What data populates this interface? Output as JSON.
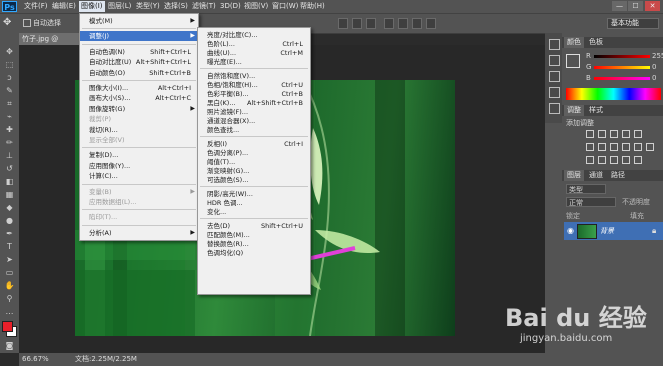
{
  "app": {
    "logo": "Ps"
  },
  "menubar": {
    "items": [
      "文件(F)",
      "编辑(E)",
      "图像(I)",
      "图层(L)",
      "类型(Y)",
      "选择(S)",
      "滤镜(T)",
      "3D(D)",
      "视图(V)",
      "窗口(W)",
      "帮助(H)"
    ],
    "window_buttons": [
      "—",
      "☐",
      "✕"
    ]
  },
  "options": {
    "auto_select": "自动选择",
    "workspace": "基本功能"
  },
  "document": {
    "tab": "竹子.jpg @ 66.7%",
    "zoom": "66.67%",
    "doc_info": "文档:2.25M/2.25M"
  },
  "image_menu": {
    "rows": [
      {
        "label": "模式(M)",
        "shortcut": "",
        "arrow": true,
        "disabled": false,
        "highlight": false
      },
      {
        "sep": true
      },
      {
        "label": "调整(J)",
        "shortcut": "",
        "arrow": true,
        "disabled": false,
        "highlight": true
      },
      {
        "sep": true
      },
      {
        "label": "自动色调(N)",
        "shortcut": "Shift+Ctrl+L",
        "arrow": false,
        "disabled": false,
        "highlight": false
      },
      {
        "label": "自动对比度(U)",
        "shortcut": "Alt+Shift+Ctrl+L",
        "arrow": false,
        "disabled": false,
        "highlight": false
      },
      {
        "label": "自动颜色(O)",
        "shortcut": "Shift+Ctrl+B",
        "arrow": false,
        "disabled": false,
        "highlight": false
      },
      {
        "sep": true
      },
      {
        "label": "图像大小(I)...",
        "shortcut": "Alt+Ctrl+I",
        "arrow": false,
        "disabled": false,
        "highlight": false
      },
      {
        "label": "画布大小(S)...",
        "shortcut": "Alt+Ctrl+C",
        "arrow": false,
        "disabled": false,
        "highlight": false
      },
      {
        "label": "图像旋转(G)",
        "shortcut": "",
        "arrow": true,
        "disabled": false,
        "highlight": false
      },
      {
        "label": "裁剪(P)",
        "shortcut": "",
        "arrow": false,
        "disabled": true,
        "highlight": false
      },
      {
        "label": "裁切(R)...",
        "shortcut": "",
        "arrow": false,
        "disabled": false,
        "highlight": false
      },
      {
        "label": "显示全部(V)",
        "shortcut": "",
        "arrow": false,
        "disabled": true,
        "highlight": false
      },
      {
        "sep": true
      },
      {
        "label": "复制(D)...",
        "shortcut": "",
        "arrow": false,
        "disabled": false,
        "highlight": false
      },
      {
        "label": "应用图像(Y)...",
        "shortcut": "",
        "arrow": false,
        "disabled": false,
        "highlight": false
      },
      {
        "label": "计算(C)...",
        "shortcut": "",
        "arrow": false,
        "disabled": false,
        "highlight": false
      },
      {
        "sep": true
      },
      {
        "label": "变量(B)",
        "shortcut": "",
        "arrow": true,
        "disabled": true,
        "highlight": false
      },
      {
        "label": "应用数据组(L)...",
        "shortcut": "",
        "arrow": false,
        "disabled": true,
        "highlight": false
      },
      {
        "sep": true
      },
      {
        "label": "陷印(T)...",
        "shortcut": "",
        "arrow": false,
        "disabled": true,
        "highlight": false
      },
      {
        "sep": true
      },
      {
        "label": "分析(A)",
        "shortcut": "",
        "arrow": true,
        "disabled": false,
        "highlight": false
      }
    ]
  },
  "adjust_menu": {
    "rows": [
      {
        "label": "亮度/对比度(C)...",
        "shortcut": ""
      },
      {
        "label": "色阶(L)...",
        "shortcut": "Ctrl+L"
      },
      {
        "label": "曲线(U)...",
        "shortcut": "Ctrl+M"
      },
      {
        "label": "曝光度(E)...",
        "shortcut": ""
      },
      {
        "sep": true
      },
      {
        "label": "自然饱和度(V)...",
        "shortcut": ""
      },
      {
        "label": "色相/饱和度(H)...",
        "shortcut": "Ctrl+U"
      },
      {
        "label": "色彩平衡(B)...",
        "shortcut": "Ctrl+B"
      },
      {
        "label": "黑白(K)...",
        "shortcut": "Alt+Shift+Ctrl+B"
      },
      {
        "label": "照片滤镜(F)...",
        "shortcut": ""
      },
      {
        "label": "通道混合器(X)...",
        "shortcut": ""
      },
      {
        "label": "颜色查找...",
        "shortcut": ""
      },
      {
        "sep": true
      },
      {
        "label": "反相(I)",
        "shortcut": "Ctrl+I"
      },
      {
        "label": "色调分离(P)...",
        "shortcut": ""
      },
      {
        "label": "阈值(T)...",
        "shortcut": ""
      },
      {
        "label": "渐变映射(G)...",
        "shortcut": ""
      },
      {
        "label": "可选颜色(S)...",
        "shortcut": ""
      },
      {
        "sep": true
      },
      {
        "label": "阴影/高光(W)...",
        "shortcut": ""
      },
      {
        "label": "HDR 色调...",
        "shortcut": ""
      },
      {
        "label": "变化...",
        "shortcut": ""
      },
      {
        "sep": true
      },
      {
        "label": "去色(D)",
        "shortcut": "Shift+Ctrl+U"
      },
      {
        "label": "匹配颜色(M)...",
        "shortcut": ""
      },
      {
        "label": "替换颜色(R)...",
        "shortcut": ""
      },
      {
        "label": "色调均化(Q)",
        "shortcut": ""
      }
    ]
  },
  "panels": {
    "color_tabs": [
      "颜色",
      "色板"
    ],
    "rgb_labels": [
      "R",
      "G",
      "B"
    ],
    "rgb_values": [
      "255",
      "0",
      "0"
    ],
    "adjust_tabs": [
      "调整",
      "样式"
    ],
    "adjust_title": "添加调整",
    "layer_tabs": [
      "图层",
      "通道",
      "路径"
    ],
    "layer_kind": "类型",
    "blend_mode": "正常",
    "opacity_label": "不透明度",
    "lock_label": "锁定",
    "fill_label": "填充",
    "layer_name": "背景"
  },
  "colors": {
    "accent": "#3f75c9",
    "foreground": "#e8202a",
    "arrow": "#e040d8"
  },
  "watermark": {
    "brand": "Bai du 经验",
    "url": "jingyan.baidu.com"
  }
}
